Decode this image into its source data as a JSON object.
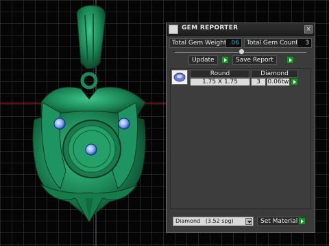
{
  "colors": {
    "viewport_bg": "#050505",
    "grid": "#4a4a4a",
    "axis_red": "#b81a1a",
    "pendant_green": "#1f8a5a",
    "gem_blue": "#8fb8ff",
    "accent_green": "#1f8f2a",
    "value_cyan": "#19b6d6"
  },
  "panel": {
    "title": "GEM REPORTER",
    "close_icon": "close-icon",
    "total_weight_label": "Total Gem Weight",
    "total_weight_value": ".06",
    "total_count_label": "Total Gem Count",
    "total_count_value": "3",
    "update_label": "Update",
    "save_report_label": "Save Report",
    "table": {
      "headers": [
        "Round",
        "Diamond"
      ],
      "row": {
        "size": "1.75 X 1.75",
        "count": "3",
        "weight": "0.06tw"
      }
    },
    "material_select": {
      "value": "Diamond",
      "detail": "(3.52 spg)"
    },
    "set_material_label": "Set Material"
  }
}
